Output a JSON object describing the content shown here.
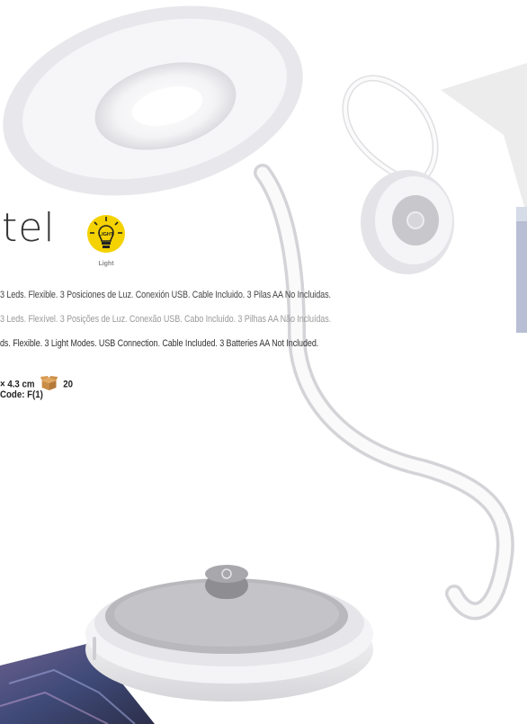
{
  "product": {
    "name": "tel",
    "badge": {
      "icon": "lightbulb-icon",
      "icon_text": "LIGHT",
      "label": "Light",
      "color": "#f4d200"
    }
  },
  "descriptions": {
    "es": "3 Leds. Flexible. 3 Posiciones de Luz. Conexión USB. Cable Incluido. 3 Pilas AA No Incluidas.",
    "pt": "3 Leds. Flexível. 3 Posições de Luz. Conexão USB. Cabo Incluído. 3 Pilhas AA Não Incluídas.",
    "en": "ds. Flexible. 3 Light Modes. USB Connection. Cable Included. 3 Batteries AA Not Included."
  },
  "specs": {
    "dimensions": "× 4.3 cm",
    "box_icon": "carton-box-icon",
    "box_quantity": "20",
    "code": "Code: F(1)"
  },
  "colors": {
    "background": "#ffffff",
    "lamp_white": "#f2f2f2",
    "lamp_gray": "#b9b9bd"
  }
}
